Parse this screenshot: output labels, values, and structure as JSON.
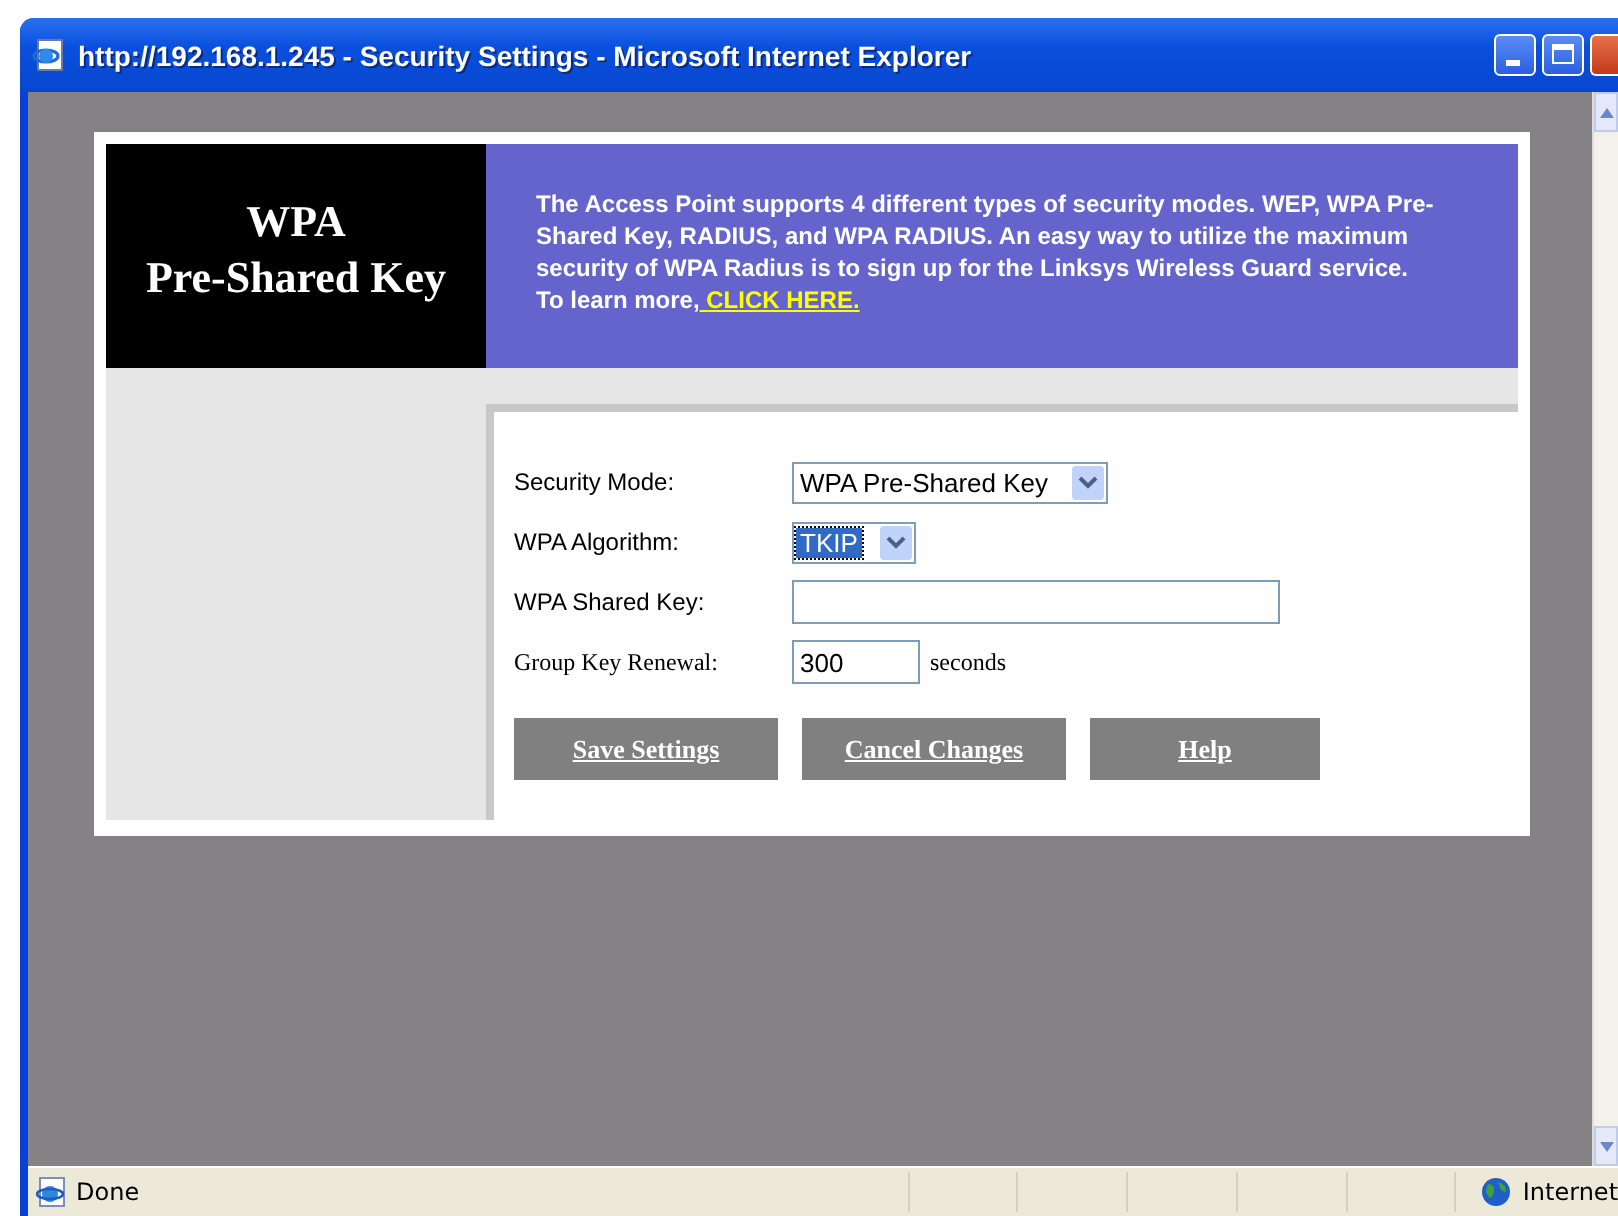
{
  "window": {
    "title": "http://192.168.1.245 - Security Settings - Microsoft Internet Explorer"
  },
  "header": {
    "title_lines": [
      "WPA",
      "Pre-Shared Key"
    ],
    "description": "The Access Point supports 4 different types of security modes. WEP, WPA Pre-Shared Key, RADIUS, and WPA RADIUS. An easy way to utilize the maximum security of WPA Radius is to sign up for the Linksys Wireless Guard service. To learn more,",
    "link": " CLICK HERE."
  },
  "form": {
    "fields": [
      {
        "kind": "select",
        "label": "Security Mode:",
        "value": "WPA Pre-Shared Key",
        "focused": false
      },
      {
        "kind": "select",
        "label": "WPA Algorithm:",
        "value": "TKIP",
        "focused": true
      },
      {
        "kind": "text",
        "label": "WPA Shared Key:"
      },
      {
        "kind": "text",
        "label": "Group Key Renewal:",
        "value": "300",
        "unit": "seconds"
      }
    ]
  },
  "buttons": [
    "Save Settings",
    "Cancel Changes",
    "Help"
  ],
  "status_bar": {
    "text": "Done",
    "zone": "Internet"
  }
}
